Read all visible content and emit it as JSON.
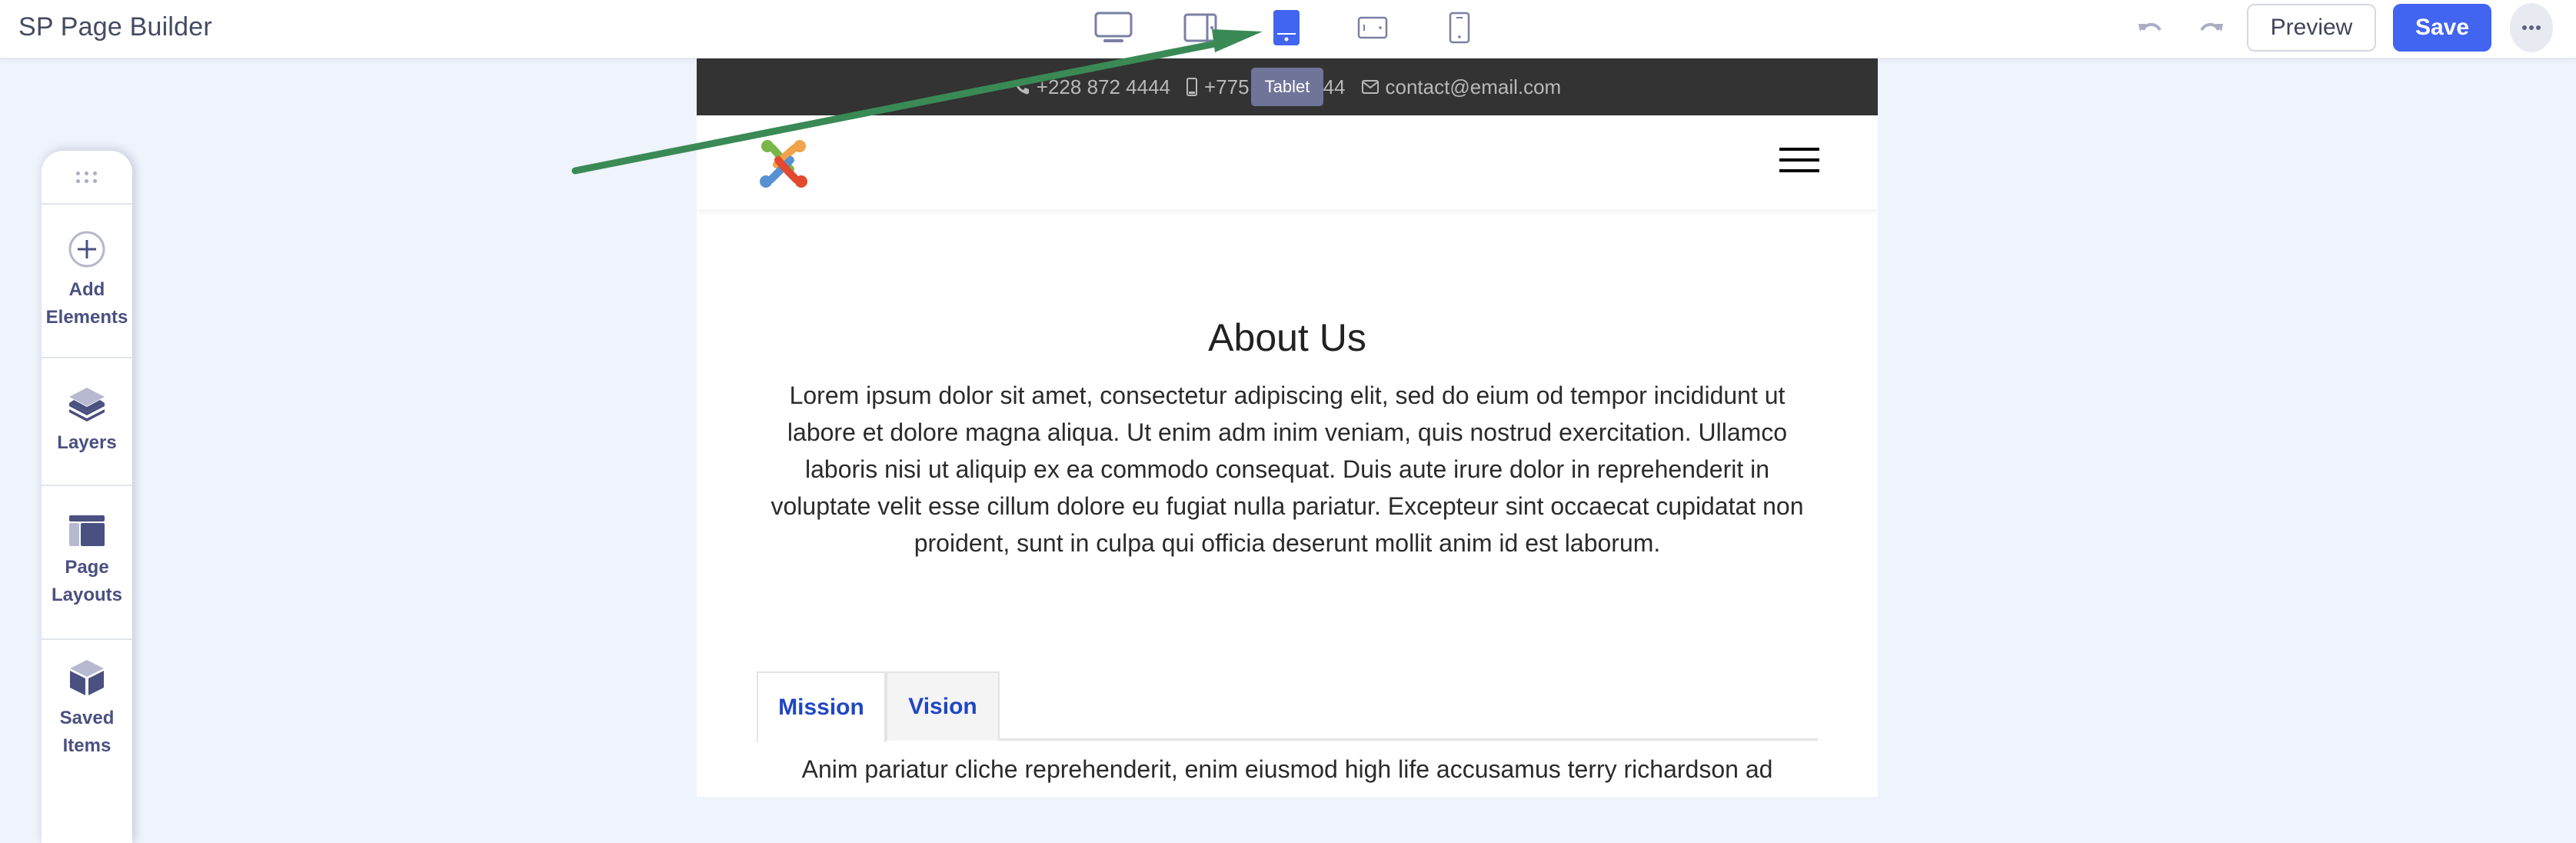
{
  "app": {
    "title": "SP Page Builder"
  },
  "device_toolbar": {
    "devices": [
      {
        "name": "desktop",
        "icon": "desktop-icon",
        "active": false
      },
      {
        "name": "laptop",
        "icon": "laptop-icon",
        "active": false
      },
      {
        "name": "tablet",
        "icon": "tablet-icon",
        "active": true
      },
      {
        "name": "tablet-landscape",
        "icon": "tablet-landscape-icon",
        "active": false
      },
      {
        "name": "mobile",
        "icon": "mobile-icon",
        "active": false
      }
    ],
    "active_color": "#4164f1",
    "tooltip": "Tablet"
  },
  "toolbar": {
    "undo_icon": "undo-icon",
    "redo_icon": "redo-icon",
    "preview_label": "Preview",
    "save_label": "Save",
    "more_icon": "more-icon",
    "save_color": "#4164f1"
  },
  "sidebar": {
    "items": [
      {
        "label": "Add Elements",
        "icon": "plus-circle-icon"
      },
      {
        "label": "Layers",
        "icon": "layers-icon"
      },
      {
        "label": "Page Layouts",
        "icon": "page-layout-icon"
      },
      {
        "label": "Saved Items",
        "icon": "box-icon"
      }
    ]
  },
  "page": {
    "topbar": {
      "phone": "+228 872 4444",
      "mobile": "+775 872 4444",
      "mobile_visible_suffix": "44",
      "mobile_visible_prefix": "+775",
      "email": "contact@email.com"
    },
    "about": {
      "title": "About Us",
      "text": "Lorem ipsum dolor sit amet, consectetur adipiscing elit, sed do eium od tempor incididunt ut labore et dolore magna aliqua. Ut enim adm inim veniam, quis nostrud exercitation. Ullamco laboris nisi ut aliquip ex ea commodo consequat. Duis aute irure dolor in reprehenderit in voluptate velit esse cillum dolore eu fugiat nulla pariatur. Excepteur sint occaecat cupidatat non proident, sunt in culpa qui officia deserunt mollit anim id est laborum."
    },
    "tabs": [
      {
        "label": "Mission",
        "active": true
      },
      {
        "label": "Vision",
        "active": false
      }
    ],
    "tab_content": "Anim pariatur cliche reprehenderit, enim eiusmod high life accusamus terry richardson ad"
  },
  "annotation": {
    "type": "arrow",
    "color": "#3a8a55",
    "points_to": "tablet-device-button"
  }
}
